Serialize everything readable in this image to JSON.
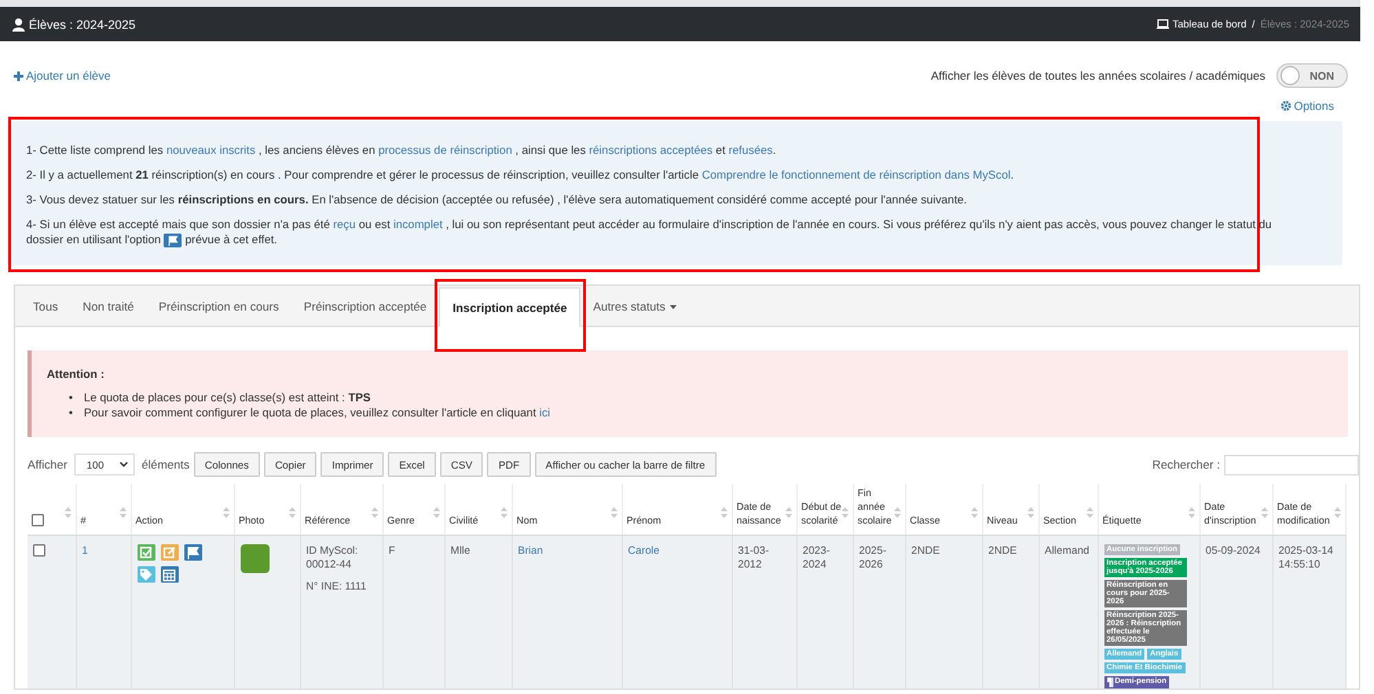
{
  "header": {
    "title": "Élèves : 2024-2025",
    "breadcrumb": [
      {
        "label": "Tableau de bord",
        "kind": "link"
      },
      {
        "label": "/",
        "kind": "separator"
      },
      {
        "label": "Élèves : 2024-2025",
        "kind": "current"
      }
    ]
  },
  "add_link": "Ajouter un élève",
  "toggle": {
    "label": "Afficher les élèves de toutes les années scolaires / académiques",
    "value": "NON",
    "on": false
  },
  "options_link": "Options",
  "info": {
    "highlighted": true,
    "lines": [
      [
        {
          "kind": "text",
          "text": "1- Cette liste comprend les "
        },
        {
          "kind": "link",
          "text": "nouveaux inscrits"
        },
        {
          "kind": "text",
          "text": " , les anciens élèves en "
        },
        {
          "kind": "link",
          "text": "processus de réinscription"
        },
        {
          "kind": "text",
          "text": " , ainsi que les "
        },
        {
          "kind": "link",
          "text": "réinscriptions acceptées"
        },
        {
          "kind": "text",
          "text": " et "
        },
        {
          "kind": "link",
          "text": "refusées"
        },
        {
          "kind": "text",
          "text": "."
        }
      ],
      [
        {
          "kind": "text",
          "text": "2- Il y a actuellement **21** réinscription(s) en cours . Pour comprendre et gérer le processus de réinscription, veuillez consulter l'article "
        },
        {
          "kind": "link",
          "text": "Comprendre le fonctionnement de réinscription dans MyScol"
        },
        {
          "kind": "text",
          "text": "."
        }
      ],
      [
        {
          "kind": "text",
          "text": "3- Vous devez statuer sur les **réinscriptions en cours.** En l'absence de décision (acceptée ou refusée) , l'élève sera automatiquement considéré comme accepté pour l'année suivante."
        }
      ],
      [
        {
          "kind": "text",
          "text": "4- Si un élève est accepté mais que son dossier n'a pas été "
        },
        {
          "kind": "link",
          "text": "reçu"
        },
        {
          "kind": "text",
          "text": " ou est "
        },
        {
          "kind": "link",
          "text": "incomplet"
        },
        {
          "kind": "text",
          "text": " , lui ou son représentant peut accéder au formulaire d'inscription de l'année en cours. Si vous préférez qu'ils n'y aient pas accès, vous pouvez changer le statut du dossier en utilisant l'option "
        },
        {
          "kind": "flag"
        },
        {
          "kind": "text",
          "text": " prévue à cet effet."
        }
      ]
    ]
  },
  "tabs": [
    {
      "label": "Tous",
      "selected": false,
      "highlighted": false,
      "kind": "tab"
    },
    {
      "label": "Non traité",
      "selected": false,
      "highlighted": false,
      "kind": "tab"
    },
    {
      "label": "Préinscription en cours",
      "selected": false,
      "highlighted": false,
      "kind": "tab"
    },
    {
      "label": "Préinscription acceptée",
      "selected": false,
      "highlighted": false,
      "kind": "tab"
    },
    {
      "label": "Inscription acceptée",
      "selected": true,
      "highlighted": true,
      "kind": "tab"
    },
    {
      "label": "Autres statuts",
      "selected": false,
      "highlighted": false,
      "kind": "dropdown"
    }
  ],
  "alert": {
    "title": "Attention :",
    "items": [
      {
        "bullet": "•",
        "text": "Le quota de places pour ce(s) classe(s) est atteint : **TPS**"
      },
      {
        "bullet": "•",
        "text": "Pour savoir comment configurer le quota de places, veuillez consulter l'article en cliquant ",
        "link": "ici"
      }
    ]
  },
  "toolbar": {
    "show_label": "Afficher",
    "page_size": "100",
    "entries_label": "éléments",
    "buttons": [
      "Colonnes",
      "Copier",
      "Imprimer",
      "Excel",
      "CSV",
      "PDF",
      "Afficher ou cacher la barre de filtre"
    ],
    "search_label": "Rechercher :"
  },
  "table": {
    "select_all_checked": false,
    "columns": [
      "#",
      "Action",
      "Photo",
      "Référence",
      "Genre",
      "Civilité",
      "Nom",
      "Prénom",
      "Date de naissance",
      "Début de scolarité",
      "Fin année scolaire",
      "Classe",
      "Niveau",
      "Section",
      "Étiquette",
      "Date d'inscription",
      "Date de modification"
    ],
    "rows": [
      {
        "checked": false,
        "number": "1",
        "actions": [
          {
            "kind": "check",
            "color": "#5cb85c"
          },
          {
            "kind": "edit",
            "color": "#f0ad4e"
          },
          {
            "kind": "flag",
            "color": "#337ab7"
          },
          {
            "kind": "tag",
            "color": "#5bc0de"
          },
          {
            "kind": "calendar",
            "color": "#337ab7"
          }
        ],
        "reference": {
          "id": "ID MyScol: 00012-44",
          "ine": "N° INE: 1111"
        },
        "genre": "F",
        "civilite": "Mlle",
        "nom": "Brian",
        "prenom": "Carole",
        "date_naissance": "31-03-2012",
        "debut": "2023-2024",
        "fin": "2025-2026",
        "classe": "2NDE",
        "niveau": "2NDE",
        "section": "Allemand",
        "labels": [
          [
            {
              "kind": "plain",
              "text": "Aucune inscription",
              "color": "#b4b8be"
            }
          ],
          [
            {
              "kind": "plain",
              "text": "Inscription acceptée jusqu'à 2025-2026",
              "color": "#00a65a"
            }
          ],
          [
            {
              "kind": "plain",
              "text": "Réinscription en cours pour 2025-2026",
              "color": "#777777"
            }
          ],
          [
            {
              "kind": "plain",
              "text": "Réinscription 2025-2026 : Réinscription effectuée le 26/05/2025",
              "color": "#777777"
            }
          ],
          [
            {
              "kind": "plain",
              "text": "Allemand",
              "color": "#5bc0de"
            },
            {
              "kind": "plain",
              "text": "Anglais",
              "color": "#5bc0de"
            }
          ],
          [
            {
              "kind": "plain",
              "text": "Chimie Et Biochimie",
              "color": "#5bc0de"
            }
          ],
          [
            {
              "kind": "meal",
              "text": "Demi-pension",
              "color": "#605ca8"
            }
          ]
        ],
        "date_inscription": "05-09-2024",
        "date_modification": "2025-03-14 14:55:10"
      }
    ]
  }
}
